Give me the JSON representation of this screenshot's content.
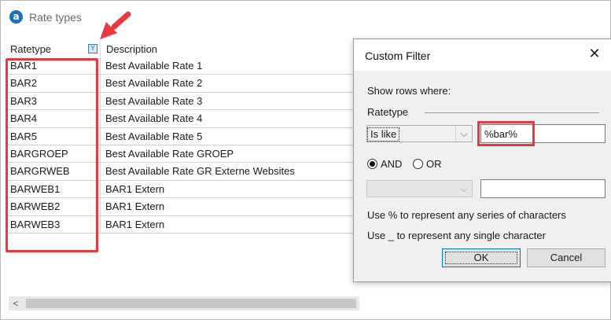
{
  "window": {
    "title": "Rate types",
    "logo_letter": "a"
  },
  "grid": {
    "headers": {
      "ratetype": "Ratetype",
      "description": "Description"
    },
    "rows": [
      {
        "ratetype": "BAR1",
        "description": "Best Available Rate 1"
      },
      {
        "ratetype": "BAR2",
        "description": "Best Available Rate 2"
      },
      {
        "ratetype": "BAR3",
        "description": "Best Available Rate 3"
      },
      {
        "ratetype": "BAR4",
        "description": "Best Available Rate 4"
      },
      {
        "ratetype": "BAR5",
        "description": "Best Available Rate 5"
      },
      {
        "ratetype": "BARGROEP",
        "description": "Best Available Rate GROEP"
      },
      {
        "ratetype": "BARGRWEB",
        "description": "Best Available Rate GR Externe Websites"
      },
      {
        "ratetype": "BARWEB1",
        "description": "BAR1 Extern"
      },
      {
        "ratetype": "BARWEB2",
        "description": "BAR1 Extern"
      },
      {
        "ratetype": "BARWEB3",
        "description": "BAR1 Extern"
      }
    ],
    "scroll_left": "<"
  },
  "dialog": {
    "title": "Custom Filter",
    "close": "✕",
    "show_rows": "Show rows where:",
    "field": "Ratetype",
    "operator1": "Is like",
    "value1": "%bar%",
    "and_label": "AND",
    "or_label": "OR",
    "operator2": "",
    "value2": "",
    "hint_percent": "Use % to represent any series of characters",
    "hint_underscore": "Use _ to represent any single character",
    "ok": "OK",
    "cancel": "Cancel"
  },
  "colors": {
    "highlight": "#e8393f",
    "accent": "#0078d7"
  },
  "icons": {
    "filter": "filter-icon",
    "dropdown": "chevron-down-icon",
    "close": "close-icon"
  }
}
